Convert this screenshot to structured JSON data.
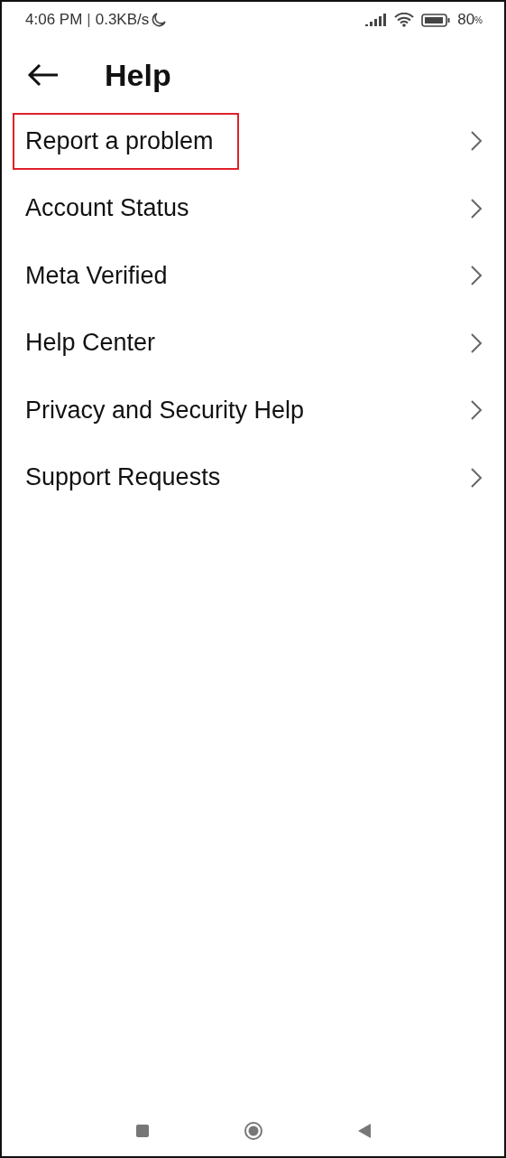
{
  "status_bar": {
    "time": "4:06 PM",
    "separator": "|",
    "speed": "0.3KB/s",
    "battery": "80",
    "battery_unit": "%"
  },
  "header": {
    "title": "Help"
  },
  "items": [
    {
      "label": "Report a problem",
      "highlighted": true
    },
    {
      "label": "Account Status",
      "highlighted": false
    },
    {
      "label": "Meta Verified",
      "highlighted": false
    },
    {
      "label": "Help Center",
      "highlighted": false
    },
    {
      "label": "Privacy and Security Help",
      "highlighted": false
    },
    {
      "label": "Support Requests",
      "highlighted": false
    }
  ]
}
